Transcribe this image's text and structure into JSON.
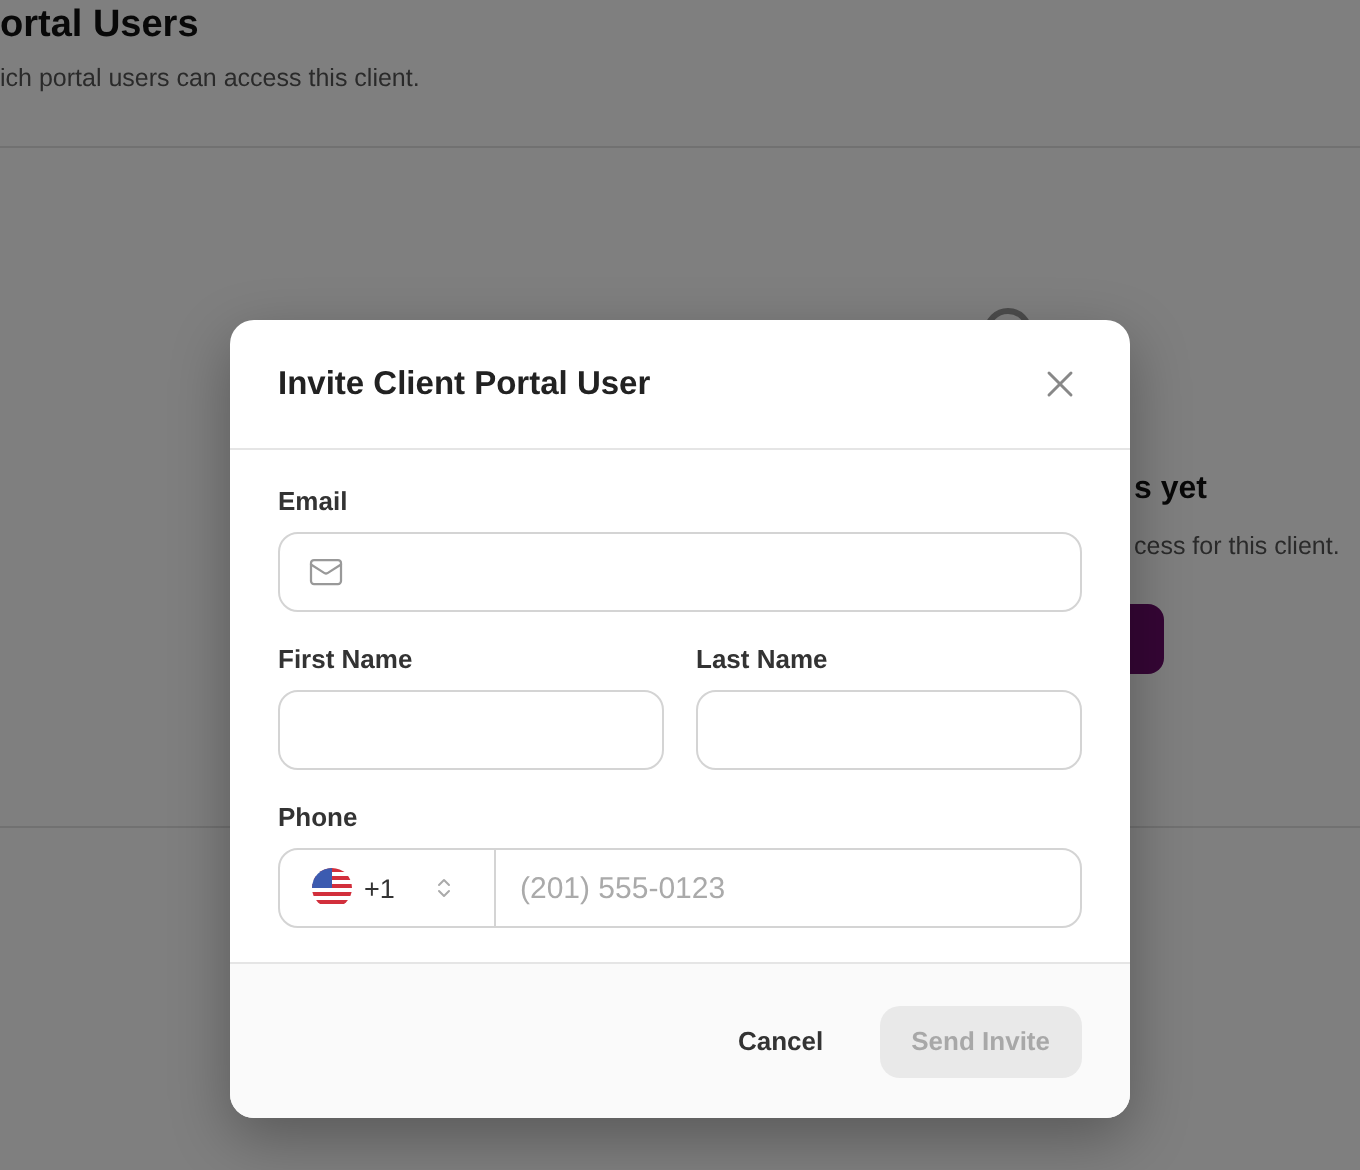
{
  "page": {
    "title": "ortal Users",
    "subtitle": "ich portal users can access this client.",
    "empty_title": "s yet",
    "empty_text": "cess for this client."
  },
  "dialog": {
    "title": "Invite Client Portal User",
    "email": {
      "label": "Email"
    },
    "first_name": {
      "label": "First Name"
    },
    "last_name": {
      "label": "Last Name"
    },
    "phone": {
      "label": "Phone",
      "country_code": "+1",
      "placeholder": "(201) 555-0123"
    },
    "buttons": [
      {
        "label": "Cancel",
        "kind": "secondary",
        "disabled": false
      },
      {
        "label": "Send Invite",
        "kind": "primary",
        "disabled": true
      }
    ]
  }
}
